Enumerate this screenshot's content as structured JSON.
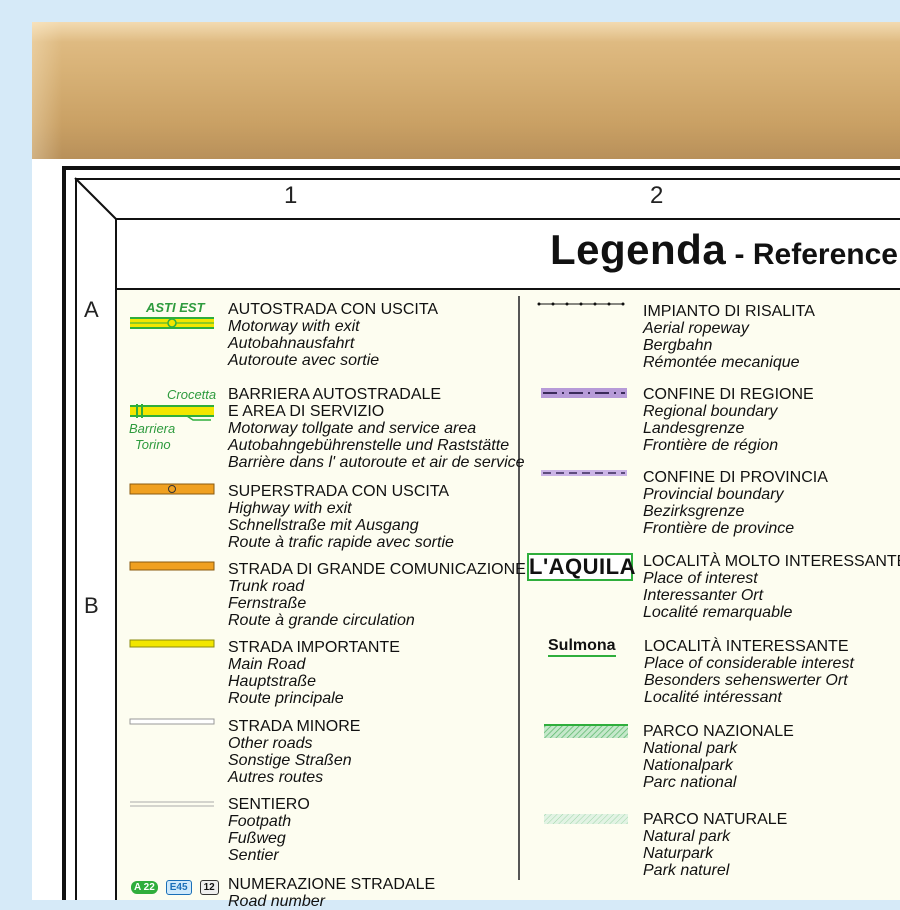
{
  "columns": [
    "1",
    "2"
  ],
  "rows": [
    "A",
    "B"
  ],
  "title": {
    "main": "Legenda",
    "sub": " - Reference -"
  },
  "left_entries": [
    {
      "head": "AUTOSTRADA CON USCITA",
      "lines": [
        "Motorway with exit",
        "Autobahnausfahrt",
        "Autoroute avec sortie"
      ]
    },
    {
      "head": "BARRIERA AUTOSTRADALE",
      "head2": "E AREA DI SERVIZIO",
      "lines": [
        "Motorway tollgate and service area",
        "Autobahngebührenstelle und Raststätte",
        "Barrière dans l' autoroute et air de service"
      ]
    },
    {
      "head": "SUPERSTRADA CON USCITA",
      "lines": [
        "Highway with exit",
        "Schnellstraße mit Ausgang",
        "Route à trafic rapide avec sortie"
      ]
    },
    {
      "head": "STRADA DI GRANDE COMUNICAZIONE",
      "lines": [
        "Trunk road",
        "Fernstraße",
        "Route à grande circulation"
      ]
    },
    {
      "head": "STRADA IMPORTANTE",
      "lines": [
        "Main Road",
        "Hauptstraße",
        "Route principale"
      ]
    },
    {
      "head": "STRADA MINORE",
      "lines": [
        "Other roads",
        "Sonstige Straßen",
        "Autres routes"
      ]
    },
    {
      "head": "SENTIERO",
      "lines": [
        "Footpath",
        "Fußweg",
        "Sentier"
      ]
    },
    {
      "head": "NUMERAZIONE STRADALE",
      "lines": [
        "Road number"
      ]
    }
  ],
  "right_entries": [
    {
      "head": "IMPIANTO DI RISALITA",
      "lines": [
        "Aerial ropeway",
        "Bergbahn",
        "Rémontée mecanique"
      ]
    },
    {
      "head": "CONFINE DI REGIONE",
      "lines": [
        "Regional boundary",
        "Landesgrenze",
        "Frontière de région"
      ]
    },
    {
      "head": "CONFINE DI PROVINCIA",
      "lines": [
        "Provincial boundary",
        "Bezirksgrenze",
        "Frontière de province"
      ]
    },
    {
      "head": "LOCALITÀ MOLTO INTERESSANTE",
      "lines": [
        "Place of interest",
        "Interessanter Ort",
        "Localité remarquable"
      ]
    },
    {
      "head": "LOCALITÀ INTERESSANTE",
      "lines": [
        "Place of considerable interest",
        "Besonders sehenswerter Ort",
        "Localité intéressant"
      ]
    },
    {
      "head": "PARCO NAZIONALE",
      "lines": [
        "National park",
        "Nationalpark",
        "Parc national"
      ]
    },
    {
      "head": "PARCO NATURALE",
      "lines": [
        "Natural park",
        "Naturpark",
        "Park naturel"
      ]
    }
  ],
  "symbols": {
    "exit_label": "ASTI EST",
    "toll_top": "Crocetta",
    "toll_bottom_1": "Barriera",
    "toll_bottom_2": "Torino",
    "major_place": "L'AQUILA",
    "minor_place": "Sulmona",
    "road_badges": [
      "A 22",
      "E45",
      "12"
    ]
  },
  "colors": {
    "motorway_yellow": "#f2e600",
    "motorway_green": "#2fae3c",
    "highway_orange": "#f0a020",
    "region_violet": "#b79bd8",
    "park_green": "#7cc98a",
    "frame_wood": "#d8b277",
    "wall_blue": "#d6eaf8"
  }
}
